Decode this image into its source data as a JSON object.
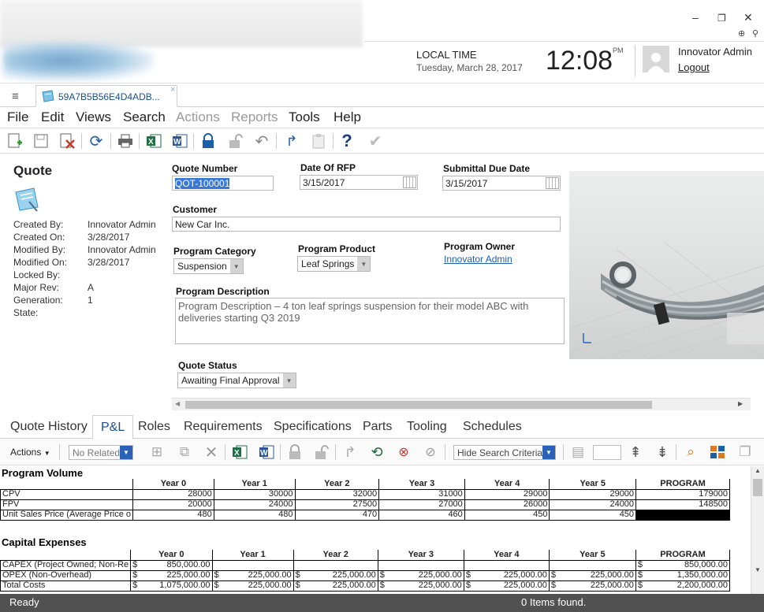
{
  "window": {
    "minimize": "–",
    "restore": "❐",
    "close": "✕"
  },
  "header": {
    "local_time_label": "LOCAL TIME",
    "date": "Tuesday, March 28, 2017",
    "time": "12:08",
    "ampm": "PM",
    "user_name": "Innovator Admin",
    "logout": "Logout"
  },
  "doc_tab": {
    "label": "59A7B5B56E4D4ADB...",
    "close": "×"
  },
  "menu": [
    "File",
    "Edit",
    "Views",
    "Search",
    "Actions",
    "Reports",
    "Tools",
    "Help"
  ],
  "form": {
    "title": "Quote",
    "meta": [
      {
        "label": "Created By:",
        "value": "Innovator Admin"
      },
      {
        "label": "Created On:",
        "value": "3/28/2017"
      },
      {
        "label": "Modified By:",
        "value": "Innovator Admin"
      },
      {
        "label": "Modified On:",
        "value": "3/28/2017"
      },
      {
        "label": "Locked By:",
        "value": ""
      },
      {
        "label": "Major Rev:",
        "value": "A"
      },
      {
        "label": "Generation:",
        "value": "1"
      },
      {
        "label": "State:",
        "value": ""
      }
    ],
    "quote_number_label": "Quote Number",
    "quote_number": "QOT-100001",
    "date_rfp_label": "Date Of RFP",
    "date_rfp": "3/15/2017",
    "due_date_label": "Submittal Due Date",
    "due_date": "3/15/2017",
    "customer_label": "Customer",
    "customer": "New Car Inc.",
    "program_category_label": "Program Category",
    "program_category": "Suspension",
    "program_product_label": "Program Product",
    "program_product": "Leaf Springs",
    "program_owner_label": "Program Owner",
    "program_owner": "Innovator Admin",
    "program_description_label": "Program Description",
    "program_description": "Program Description – 4 ton leaf springs suspension for their model ABC with deliveries starting Q3 2019",
    "quote_status_label": "Quote Status",
    "quote_status": "Awaiting Final Approval"
  },
  "subtabs": [
    "Quote History",
    "P&L",
    "Roles",
    "Requirements",
    "Specifications",
    "Parts",
    "Tooling",
    "Schedules"
  ],
  "subtoolbar": {
    "actions": "Actions",
    "no_related": "No Related",
    "hide_search": "Hide Search Criteria"
  },
  "program_volume": {
    "title": "Program Volume",
    "headers": [
      "",
      "Year 0",
      "Year 1",
      "Year 2",
      "Year 3",
      "Year 4",
      "Year 5",
      "PROGRAM"
    ],
    "rows": [
      [
        "CPV",
        "28000",
        "30000",
        "32000",
        "31000",
        "29000",
        "29000",
        "179000"
      ],
      [
        "FPV",
        "20000",
        "24000",
        "27500",
        "27000",
        "26000",
        "24000",
        "148500"
      ],
      [
        "Unit Sales Price (Average Price o",
        "480",
        "480",
        "470",
        "460",
        "450",
        "450",
        ""
      ]
    ]
  },
  "capital_expenses": {
    "title": "Capital Expenses",
    "headers": [
      "",
      "Year 0",
      "Year 1",
      "Year 2",
      "Year 3",
      "Year 4",
      "Year 5",
      "PROGRAM"
    ],
    "rows": [
      [
        "CAPEX (Project Owned; Non-Re",
        "850,000.00",
        "",
        "",
        "",
        "",
        "",
        "850,000.00"
      ],
      [
        "OPEX (Non-Overhead)",
        "225,000.00",
        "225,000.00",
        "225,000.00",
        "225,000.00",
        "225,000.00",
        "225,000.00",
        "1,350,000.00"
      ],
      [
        "Total Costs",
        "1,075,000.00",
        "225,000.00",
        "225,000.00",
        "225,000.00",
        "225,000.00",
        "225,000.00",
        "2,200,000.00"
      ]
    ]
  },
  "status": {
    "left": "Ready",
    "center": "0 Items found."
  }
}
